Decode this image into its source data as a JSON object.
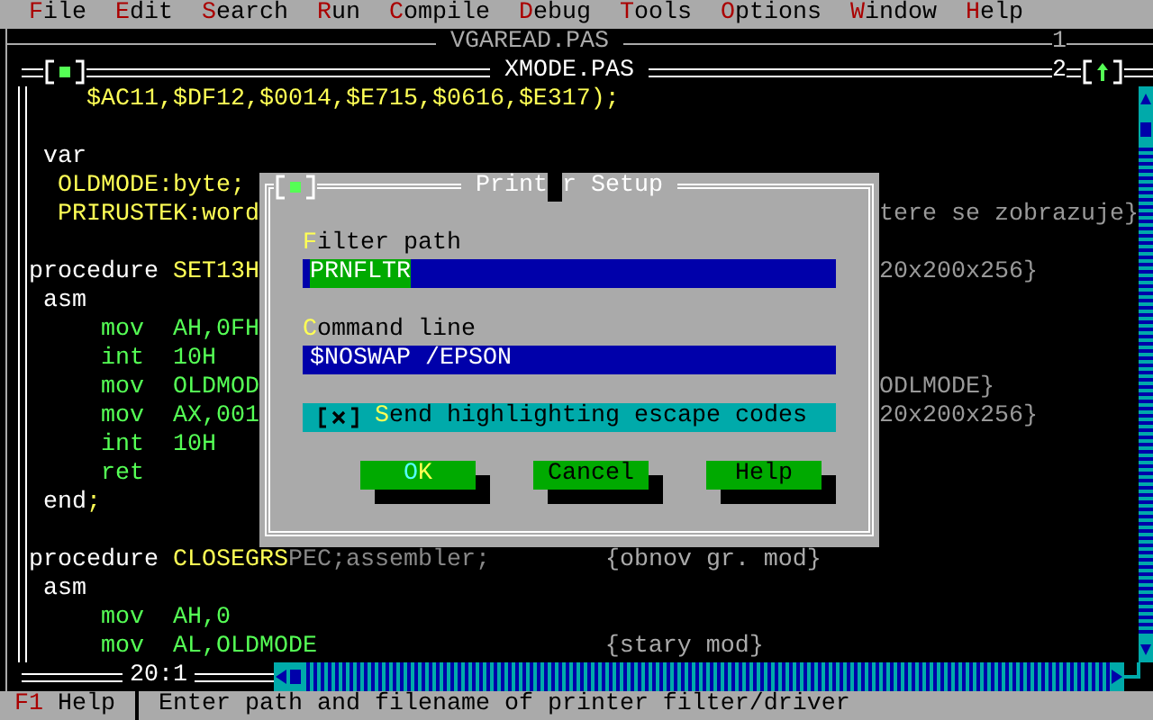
{
  "menu_bar": {
    "items": [
      {
        "hotkey": "F",
        "after": "ile"
      },
      {
        "hotkey": "E",
        "after": "dit"
      },
      {
        "hotkey": "S",
        "after": "earch"
      },
      {
        "hotkey": "R",
        "after": "un"
      },
      {
        "hotkey": "C",
        "after": "ompile"
      },
      {
        "hotkey": "D",
        "after": "ebug"
      },
      {
        "hotkey": "T",
        "after": "ools"
      },
      {
        "hotkey": "O",
        "after": "ptions"
      },
      {
        "hotkey": "W",
        "after": "indow"
      },
      {
        "hotkey": "H",
        "after": "elp"
      }
    ]
  },
  "back_window": {
    "title": "VGAREAD.PAS",
    "number": "1"
  },
  "editor_window": {
    "title": "XMODE.PAS",
    "number": "2",
    "position": "20:1",
    "lines": [
      {
        "kind": "code",
        "segments": [
          {
            "kind": "ident",
            "text": "    $AC11,$DF12,$0014,$E715,$0616,$E317);"
          }
        ]
      },
      {
        "kind": "blank"
      },
      {
        "kind": "code",
        "segments": [
          {
            "kind": "keyword",
            "text": " var"
          }
        ]
      },
      {
        "kind": "code",
        "segments": [
          {
            "kind": "ident",
            "text": "  OLDMODE:byte;"
          }
        ]
      },
      {
        "kind": "code",
        "segments": [
          {
            "kind": "ident",
            "text": "  PRIRUSTEK:word"
          }
        ],
        "right": "tere se zobrazuje}"
      },
      {
        "kind": "blank"
      },
      {
        "kind": "code",
        "segments": [
          {
            "kind": "keyword",
            "text": "procedure "
          },
          {
            "kind": "ident",
            "text": "SET13H"
          }
        ],
        "right": "20x200x256}"
      },
      {
        "kind": "code",
        "segments": [
          {
            "kind": "keyword",
            "text": " asm"
          }
        ]
      },
      {
        "kind": "code",
        "segments": [
          {
            "kind": "asm",
            "text": "     mov  AH,0FH"
          }
        ]
      },
      {
        "kind": "code",
        "segments": [
          {
            "kind": "asm",
            "text": "     int  10H"
          }
        ]
      },
      {
        "kind": "code",
        "segments": [
          {
            "kind": "asm",
            "text": "     mov  OLDMOD"
          }
        ],
        "right": "ODLMODE}"
      },
      {
        "kind": "code",
        "segments": [
          {
            "kind": "asm",
            "text": "     mov  AX,001"
          }
        ],
        "right": "20x200x256}"
      },
      {
        "kind": "code",
        "segments": [
          {
            "kind": "asm",
            "text": "     int  10H"
          }
        ]
      },
      {
        "kind": "code",
        "segments": [
          {
            "kind": "asm",
            "text": "     ret"
          }
        ]
      },
      {
        "kind": "code",
        "segments": [
          {
            "kind": "keyword",
            "text": " end"
          },
          {
            "kind": "ident",
            "text": ";"
          }
        ]
      },
      {
        "kind": "blank"
      },
      {
        "kind": "code",
        "segments": [
          {
            "kind": "keyword",
            "text": "procedure "
          },
          {
            "kind": "ident",
            "text": "CLOSEGRS"
          },
          {
            "kind": "shadowed",
            "text": "PEC;assembler;"
          },
          {
            "kind": "comment",
            "text": "        {obnov gr. mod}"
          }
        ]
      },
      {
        "kind": "code",
        "segments": [
          {
            "kind": "keyword",
            "text": " asm"
          }
        ]
      },
      {
        "kind": "code",
        "segments": [
          {
            "kind": "asm",
            "text": "     mov  AH,0"
          }
        ]
      },
      {
        "kind": "code",
        "segments": [
          {
            "kind": "asm",
            "text": "     mov  AL,OLDMODE"
          },
          {
            "kind": "comment",
            "text": "                    {stary mod}"
          }
        ]
      }
    ]
  },
  "dialog": {
    "title_before_cursor": "Print",
    "title_after_cursor": "r Setup",
    "fields": [
      {
        "label": {
          "hotkey": "F",
          "after": "ilter path"
        },
        "value": "PRNFLTR",
        "value_selected": true
      },
      {
        "label": {
          "hotkey": "C",
          "after": "ommand line"
        },
        "value": "$NOSWAP /EPSON",
        "value_selected": false
      }
    ],
    "checkbox": {
      "checked": true,
      "label": {
        "hotkey": "S",
        "after": "end highlighting escape codes"
      }
    },
    "buttons": [
      {
        "before": "O",
        "hotkey": "K",
        "default": true
      },
      {
        "before": "Cancel",
        "default": false
      },
      {
        "before": "Help",
        "default": false
      }
    ]
  },
  "status_bar": {
    "key": "F1",
    "key_label": "Help",
    "hint": "Enter path and filename of printer filter/driver"
  }
}
